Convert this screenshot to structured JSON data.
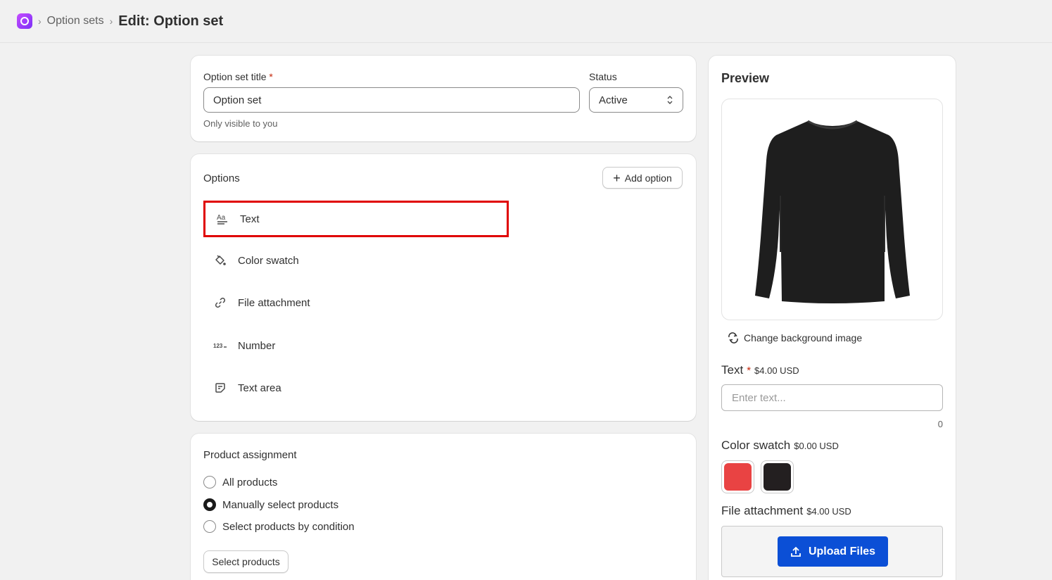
{
  "breadcrumb": {
    "parent": "Option sets",
    "current": "Edit: Option set"
  },
  "details": {
    "title_label": "Option set title",
    "required_mark": "*",
    "title_value": "Option set",
    "title_help": "Only visible to you",
    "status_label": "Status",
    "status_value": "Active"
  },
  "options": {
    "heading": "Options",
    "add_label": "Add option",
    "items": [
      {
        "label": "Text",
        "icon": "text-format-icon"
      },
      {
        "label": "Color swatch",
        "icon": "paint-bucket-icon"
      },
      {
        "label": "File attachment",
        "icon": "link-icon"
      },
      {
        "label": "Number",
        "icon": "number-icon"
      },
      {
        "label": "Text area",
        "icon": "note-icon"
      }
    ]
  },
  "assignment": {
    "heading": "Product assignment",
    "choices": [
      "All products",
      "Manually select products",
      "Select products by condition"
    ],
    "selected_index": 1,
    "select_button": "Select products"
  },
  "preview": {
    "heading": "Preview",
    "change_bg": "Change background image",
    "text_label": "Text",
    "text_required": "*",
    "text_price": "$4.00 USD",
    "text_placeholder": "Enter text...",
    "text_count": "0",
    "swatch_label": "Color swatch",
    "swatch_price": "$0.00 USD",
    "swatches": [
      "#e94343",
      "#231f20"
    ],
    "file_label": "File attachment",
    "file_price": "$4.00 USD",
    "upload_label": "Upload Files"
  },
  "colors": {
    "accent_blue": "#0b4fd6",
    "highlight_red": "#e00000",
    "brand_purple": "#9b3cf8"
  }
}
